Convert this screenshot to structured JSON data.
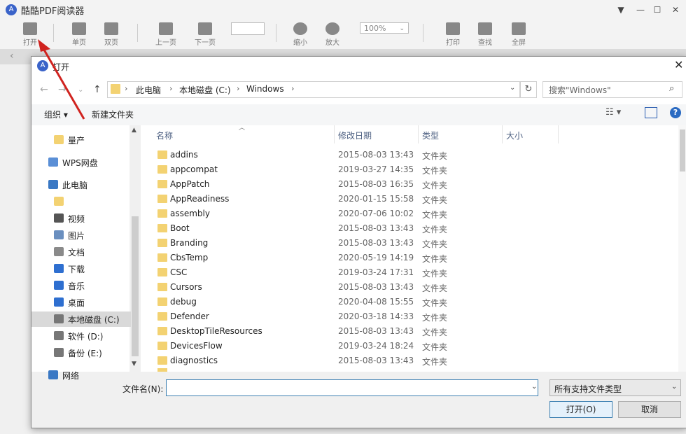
{
  "app": {
    "title": "酷酷PDF阅读器",
    "logo_glyph": "A",
    "window_controls": {
      "menu": "▼",
      "minimize": "—",
      "maximize": "☐",
      "close": "✕"
    },
    "toolbar": {
      "open": "打开",
      "single_page": "单页",
      "double_page": "双页",
      "prev_page": "上一页",
      "next_page": "下一页",
      "zoom_out": "缩小",
      "zoom_in": "放大",
      "zoom_value": "100%",
      "print": "打印",
      "find": "查找",
      "fullscreen": "全屏"
    }
  },
  "dialog": {
    "title": "打开",
    "breadcrumb": [
      "此电脑",
      "本地磁盘 (C:)",
      "Windows"
    ],
    "search_placeholder": "搜索\"Windows\"",
    "organize": "组织 ▾",
    "new_folder": "新建文件夹",
    "nav": [
      {
        "label": "量产",
        "icon": "folder-icon"
      },
      {
        "label": "WPS网盘",
        "icon": "cloud-icon"
      },
      {
        "label": "此电脑",
        "icon": "computer-icon"
      },
      {
        "label": "",
        "icon": "folder-icon"
      },
      {
        "label": "视频",
        "icon": "video-icon"
      },
      {
        "label": "图片",
        "icon": "picture-icon"
      },
      {
        "label": "文档",
        "icon": "document-icon"
      },
      {
        "label": "下载",
        "icon": "download-icon"
      },
      {
        "label": "音乐",
        "icon": "music-icon"
      },
      {
        "label": "桌面",
        "icon": "desktop-icon"
      },
      {
        "label": "本地磁盘 (C:)",
        "icon": "drive-icon"
      },
      {
        "label": "软件 (D:)",
        "icon": "drive-icon"
      },
      {
        "label": "备份 (E:)",
        "icon": "drive-icon"
      },
      {
        "label": "网络",
        "icon": "network-icon"
      }
    ],
    "columns": {
      "name": "名称",
      "date": "修改日期",
      "type": "类型",
      "size": "大小"
    },
    "files": [
      {
        "name": "addins",
        "date": "2015-08-03 13:43",
        "type": "文件夹"
      },
      {
        "name": "appcompat",
        "date": "2019-03-27 14:35",
        "type": "文件夹"
      },
      {
        "name": "AppPatch",
        "date": "2015-08-03 16:35",
        "type": "文件夹"
      },
      {
        "name": "AppReadiness",
        "date": "2020-01-15 15:58",
        "type": "文件夹"
      },
      {
        "name": "assembly",
        "date": "2020-07-06 10:02",
        "type": "文件夹"
      },
      {
        "name": "Boot",
        "date": "2015-08-03 13:43",
        "type": "文件夹"
      },
      {
        "name": "Branding",
        "date": "2015-08-03 13:43",
        "type": "文件夹"
      },
      {
        "name": "CbsTemp",
        "date": "2020-05-19 14:19",
        "type": "文件夹"
      },
      {
        "name": "CSC",
        "date": "2019-03-24 17:31",
        "type": "文件夹"
      },
      {
        "name": "Cursors",
        "date": "2015-08-03 13:43",
        "type": "文件夹"
      },
      {
        "name": "debug",
        "date": "2020-04-08 15:55",
        "type": "文件夹"
      },
      {
        "name": "Defender",
        "date": "2020-03-18 14:33",
        "type": "文件夹"
      },
      {
        "name": "DesktopTileResources",
        "date": "2015-08-03 13:43",
        "type": "文件夹"
      },
      {
        "name": "DevicesFlow",
        "date": "2019-03-24 18:24",
        "type": "文件夹"
      },
      {
        "name": "diagnostics",
        "date": "2015-08-03 13:43",
        "type": "文件夹"
      }
    ],
    "filename_label": "文件名(N):",
    "filename_value": "",
    "filetype": "所有支持文件类型",
    "open_button": "打开(O)",
    "cancel_button": "取消"
  },
  "colors": {
    "accent": "#3a63c9",
    "folder": "#f3d272",
    "arrow": "#d0231f"
  }
}
